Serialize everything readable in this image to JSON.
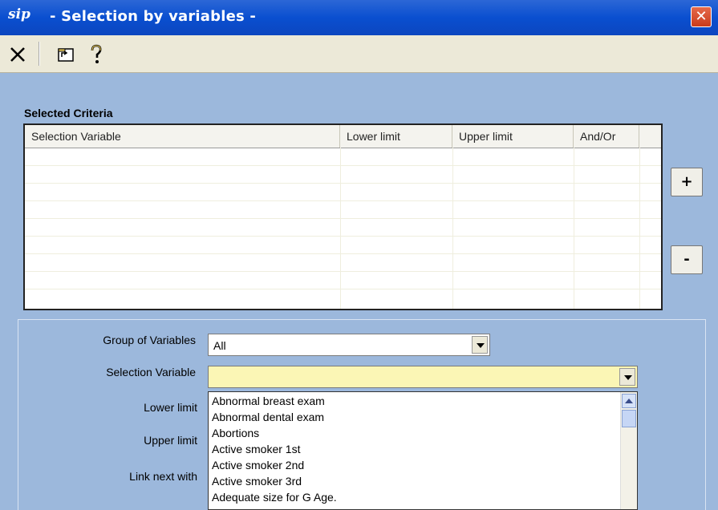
{
  "window": {
    "title": "- Selection by variables -",
    "app_icon_text": "sip",
    "close_symbol": "✕"
  },
  "toolbar": {
    "buttons": [
      {
        "icon": "close-x-icon"
      },
      {
        "icon": "return-to-parent-icon"
      },
      {
        "icon": "help-question-icon"
      }
    ]
  },
  "criteria": {
    "label": "Selected Criteria",
    "columns": [
      "Selection Variable",
      "Lower limit",
      "Upper limit",
      "And/Or"
    ],
    "rows": []
  },
  "side_buttons": {
    "add": "+",
    "remove": "-"
  },
  "form": {
    "group_label": "Group of Variables",
    "group_value": "All",
    "selvar_label": "Selection Variable",
    "selvar_value": "",
    "lower_label": "Lower limit",
    "upper_label": "Upper limit",
    "link_label": "Link next with"
  },
  "dropdown": {
    "items": [
      "Abnormal breast exam",
      "Abnormal dental exam",
      "Abortions",
      "Active smoker 1st",
      "Active smoker 2nd",
      "Active smoker 3rd",
      "Adequate size for G Age."
    ]
  },
  "colors": {
    "title_bar": "#0a4fd0",
    "background": "#9cb8dc",
    "field_highlight": "#fbf6b5"
  }
}
